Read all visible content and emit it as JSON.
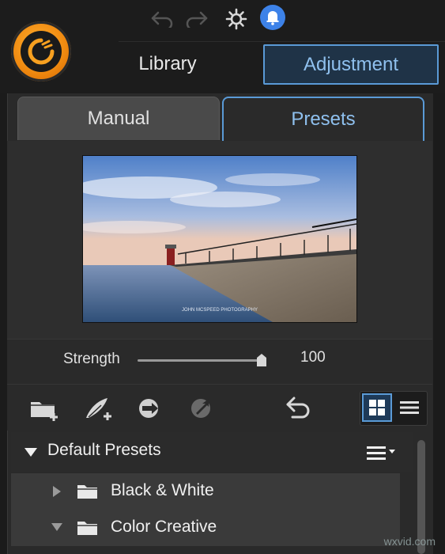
{
  "top": {
    "icons": [
      "undo-icon",
      "redo-icon",
      "settings-gear-icon",
      "notification-bell-icon"
    ],
    "logo": "app-logo"
  },
  "main_tabs": {
    "library": "Library",
    "adjustment": "Adjustment",
    "active": "Adjustment"
  },
  "sub_tabs": {
    "manual": "Manual",
    "presets": "Presets",
    "active": "Presets"
  },
  "preview": {
    "watermark_text": "JOHN MCSPEED PHOTOGRAPHY"
  },
  "strength": {
    "label": "Strength",
    "value": "100",
    "slider_fraction": 1.0
  },
  "toolbar": {
    "tools": [
      "new-folder-icon",
      "add-preset-icon",
      "import-preset-icon",
      "export-preset-icon",
      "reset-icon"
    ],
    "view_mode": "grid"
  },
  "presets": {
    "group": "Default Presets",
    "items": [
      {
        "label": "Black & White",
        "expanded": false
      },
      {
        "label": "Color Creative",
        "expanded": true
      }
    ]
  },
  "site_watermark": "wxvid.com",
  "colors": {
    "accent": "#5a9ad6",
    "accent_text": "#8fc0ee",
    "logo_orange": "#f08a10"
  }
}
